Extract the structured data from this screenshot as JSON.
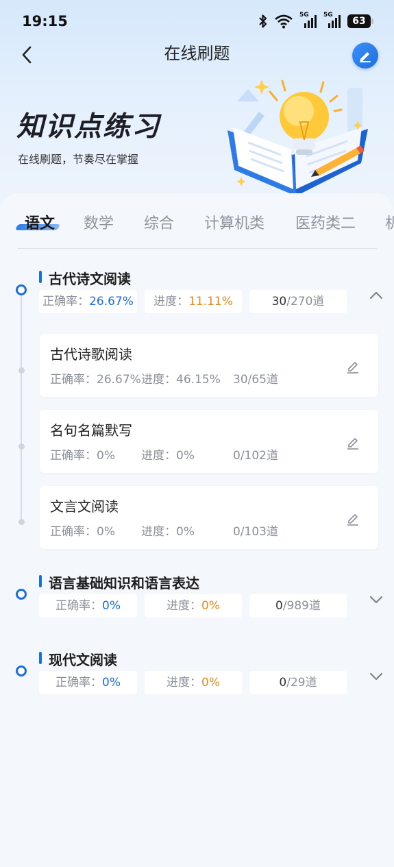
{
  "status_bar": {
    "time": "19:15",
    "battery": "63",
    "signal1": "5G",
    "signal2": "5G"
  },
  "header": {
    "title": "在线刷题",
    "back_icon": "chevron-left-icon",
    "edit_icon": "pen-icon"
  },
  "hero": {
    "title": "知识点练习",
    "subtitle": "在线刷题，节奏尽在掌握",
    "illustration": "lightbulb-book-illustration"
  },
  "tabs": [
    {
      "label": "语文",
      "active": true
    },
    {
      "label": "数学",
      "active": false
    },
    {
      "label": "综合",
      "active": false
    },
    {
      "label": "计算机类",
      "active": false
    },
    {
      "label": "医药类二",
      "active": false
    },
    {
      "label": "机",
      "active": false
    }
  ],
  "sections": [
    {
      "title": "古代诗文阅读",
      "accuracy_label": "正确率：",
      "accuracy": "26.67%",
      "progress_label": "进度：",
      "progress": "11.11%",
      "done": "30",
      "total": "/270道",
      "expanded": true,
      "topics": [
        {
          "title": "古代诗歌阅读",
          "accuracy": "正确率：26.67%",
          "progress": "进度：46.15%",
          "count": "30/65道"
        },
        {
          "title": "名句名篇默写",
          "accuracy": "正确率：0%",
          "progress": "进度：0%",
          "count": "0/102道"
        },
        {
          "title": "文言文阅读",
          "accuracy": "正确率：0%",
          "progress": "进度：0%",
          "count": "0/103道"
        }
      ]
    },
    {
      "title": "语言基础知识和语言表达",
      "accuracy_label": "正确率：",
      "accuracy": "0%",
      "progress_label": "进度：",
      "progress": "0%",
      "done": "0",
      "total": "/989道",
      "expanded": false
    },
    {
      "title": "现代文阅读",
      "accuracy_label": "正确率：",
      "accuracy": "0%",
      "progress_label": "进度：",
      "progress": "0%",
      "done": "0",
      "total": "/29道",
      "expanded": false
    }
  ],
  "colors": {
    "accent": "#1a6ee0",
    "progress": "#e58a1c"
  }
}
